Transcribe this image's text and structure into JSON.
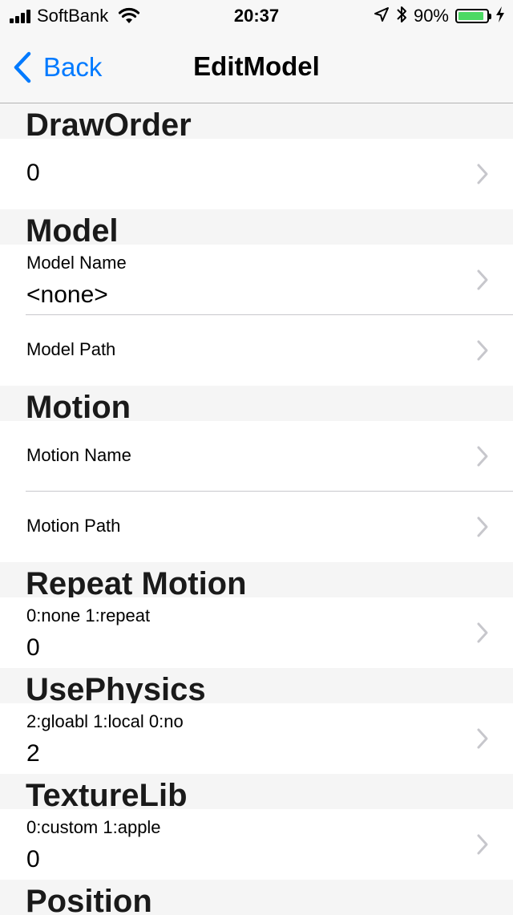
{
  "status_bar": {
    "carrier": "SoftBank",
    "time": "20:37",
    "battery_percent": "90%",
    "battery_level": 0.9,
    "icons": [
      "signal-icon",
      "wifi-icon",
      "location-icon",
      "bluetooth-icon",
      "battery-icon",
      "charging-icon"
    ]
  },
  "nav": {
    "back_label": "Back",
    "title": "EditModel"
  },
  "sections": {
    "draw_order": {
      "header": "DrawOrder",
      "value": "0"
    },
    "model": {
      "header": "Model",
      "name_label": "Model Name",
      "name_value": "<none>",
      "path_label": "Model Path"
    },
    "motion": {
      "header": "Motion",
      "name_label": "Motion Name",
      "path_label": "Motion Path"
    },
    "repeat_motion": {
      "header": "Repeat Motion",
      "subtitle": "0:none 1:repeat",
      "value": "0"
    },
    "use_physics": {
      "header": "UsePhysics",
      "subtitle": "2:gloabl 1:local 0:no",
      "value": "2"
    },
    "texture_lib": {
      "header": "TextureLib",
      "subtitle": "0:custom 1:apple",
      "value": "0"
    },
    "position": {
      "header": "Position"
    }
  },
  "colors": {
    "accent": "#007aff",
    "battery": "#4cd964",
    "chevron": "#c7c7cc",
    "section_bg": "#f5f5f5"
  }
}
